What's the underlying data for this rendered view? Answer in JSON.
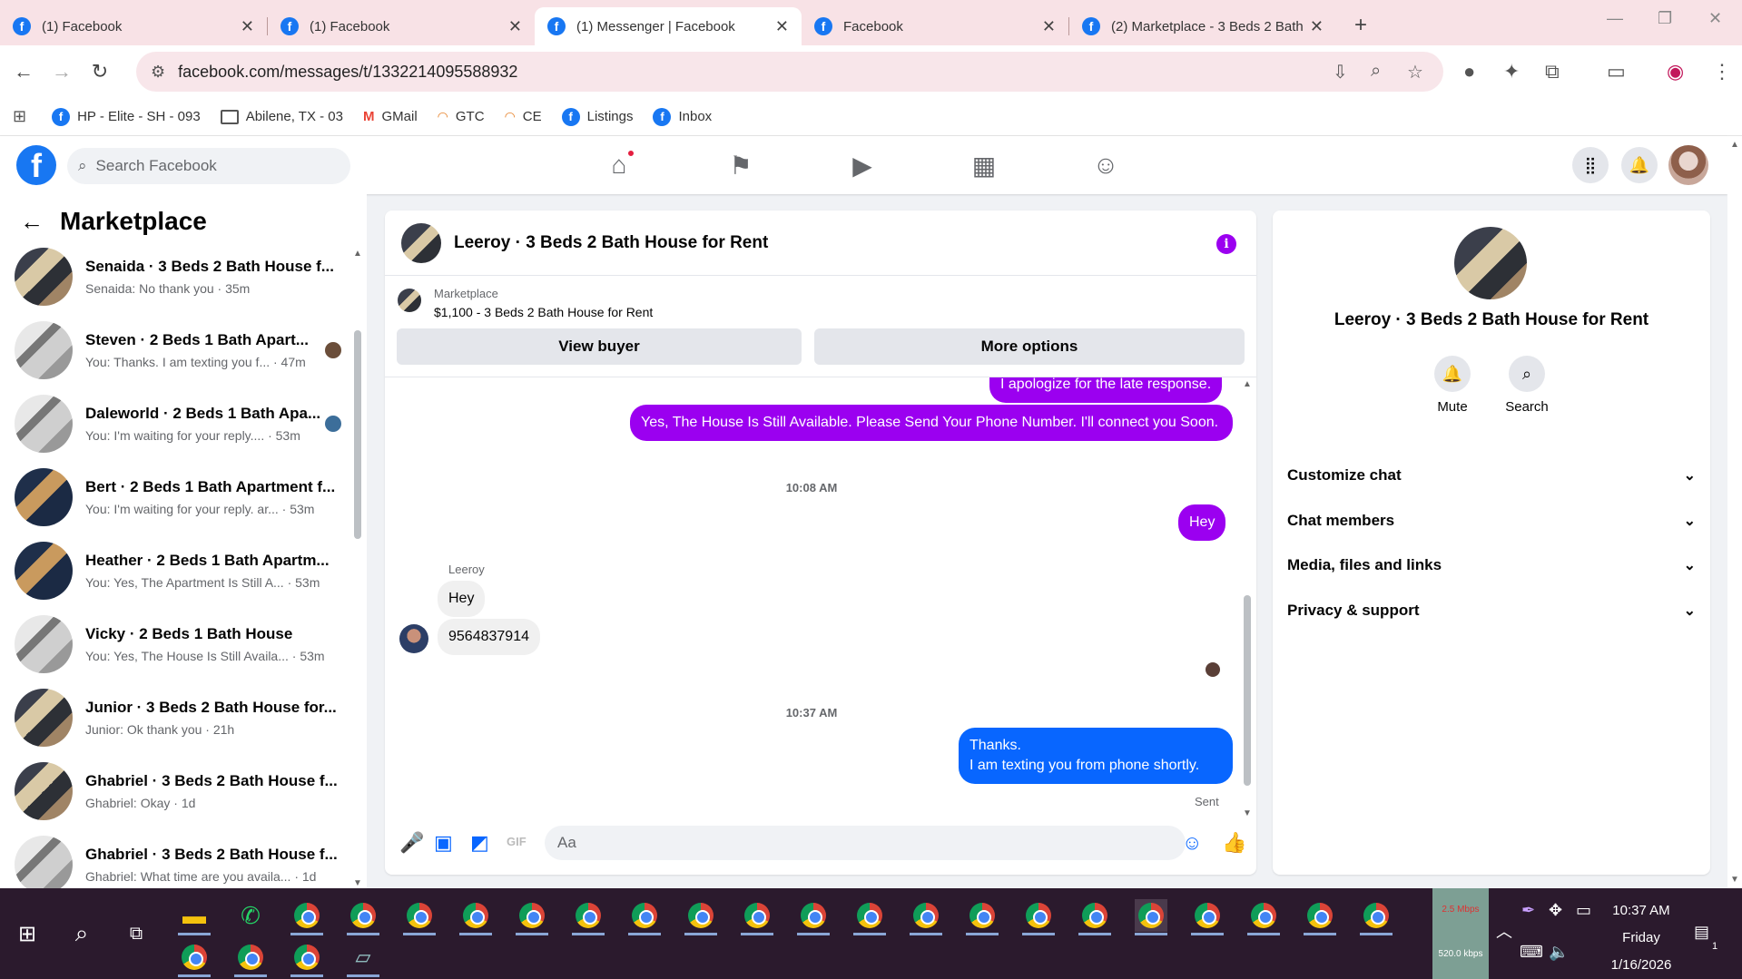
{
  "browser": {
    "tabs": [
      {
        "title": "(1) Facebook",
        "active": false
      },
      {
        "title": "(1) Facebook",
        "active": false
      },
      {
        "title": "(1) Messenger | Facebook",
        "active": true
      },
      {
        "title": "Facebook",
        "active": false
      },
      {
        "title": "(2) Marketplace - 3 Beds 2 Bath",
        "active": false
      }
    ],
    "new_tab": "+",
    "url": "facebook.com/messages/t/1332214095588932",
    "bookmarks": [
      {
        "label": "HP - Elite - SH - 093",
        "icon": "facebook-icon"
      },
      {
        "label": "Abilene, TX - 03",
        "icon": "folder-icon"
      },
      {
        "label": "GMail",
        "icon": "gmail-icon"
      },
      {
        "label": "GTC",
        "icon": "rainbow-icon"
      },
      {
        "label": "CE",
        "icon": "rainbow-icon"
      },
      {
        "label": "Listings",
        "icon": "facebook-icon"
      },
      {
        "label": "Inbox",
        "icon": "facebook-icon"
      }
    ]
  },
  "fb": {
    "search_placeholder": "Search Facebook",
    "nav": [
      "home-icon",
      "flag-icon",
      "video-icon",
      "marketplace-icon",
      "groups-icon"
    ]
  },
  "left": {
    "title": "Marketplace",
    "conversations": [
      {
        "name": "Senaida · 3 Beds 2 Bath House f...",
        "preview": "Senaida: No thank you · 35m",
        "thumb": "dark"
      },
      {
        "name": "Steven · 2 Beds 1 Bath Apart...",
        "preview": "You: Thanks. I am texting you f... · 47m",
        "thumb": "light",
        "seen": true
      },
      {
        "name": "Daleworld · 2 Beds 1 Bath Apa...",
        "preview": "You: I'm waiting for your reply.... · 53m",
        "thumb": "light",
        "seen": true
      },
      {
        "name": "Bert · 2 Beds 1 Bath Apartment f...",
        "preview": "You: I'm waiting for your reply. ar... · 53m",
        "thumb": "blue"
      },
      {
        "name": "Heather · 2 Beds 1 Bath Apartm...",
        "preview": "You: Yes, The Apartment Is Still A... · 53m",
        "thumb": "blue"
      },
      {
        "name": "Vicky · 2 Beds 1 Bath House",
        "preview": "You: Yes, The House Is Still Availa... · 53m",
        "thumb": "light"
      },
      {
        "name": "Junior · 3 Beds 2 Bath House for...",
        "preview": "Junior: Ok thank you · 21h",
        "thumb": "dark"
      },
      {
        "name": "Ghabriel · 3 Beds 2 Bath House f...",
        "preview": "Ghabriel: Okay · 1d",
        "thumb": "dark"
      },
      {
        "name": "Ghabriel · 3 Beds 2 Bath House f...",
        "preview": "Ghabriel: What time are you availa... · 1d",
        "thumb": "light"
      }
    ]
  },
  "chat": {
    "title": "Leeroy · 3 Beds 2 Bath House for Rent",
    "marketplace_label": "Marketplace",
    "listing": "$1,100 - 3 Beds 2 Bath House for Rent",
    "view_buyer": "View buyer",
    "more_options": "More options",
    "messages": {
      "m1": "I apologize for the late response.",
      "m2": "Yes, The House Is Still Available. Please Send Your Phone Number. I'll connect you Soon.",
      "ts1": "10:08 AM",
      "m3": "Hey",
      "sender": "Leeroy",
      "m4": "Hey",
      "m5": "9564837914",
      "ts2": "10:37 AM",
      "m6a": "Thanks.",
      "m6b": "I am texting you from phone shortly.",
      "status": "Sent"
    },
    "input_placeholder": "Aa",
    "composer_icons": [
      "mic-icon",
      "photo-icon",
      "sticker-icon",
      "gif-icon",
      "emoji-icon",
      "like-icon"
    ]
  },
  "right": {
    "name": "Leeroy · 3 Beds 2 Bath House for Rent",
    "mute": "Mute",
    "search": "Search",
    "sections": [
      "Customize chat",
      "Chat members",
      "Media, files and links",
      "Privacy & support"
    ]
  },
  "taskbar": {
    "net_down": "2.5 Mbps",
    "net_up": "520.0 kbps",
    "time": "10:37 AM",
    "day": "Friday",
    "date": "1/16/2026",
    "notif_count": "1"
  }
}
